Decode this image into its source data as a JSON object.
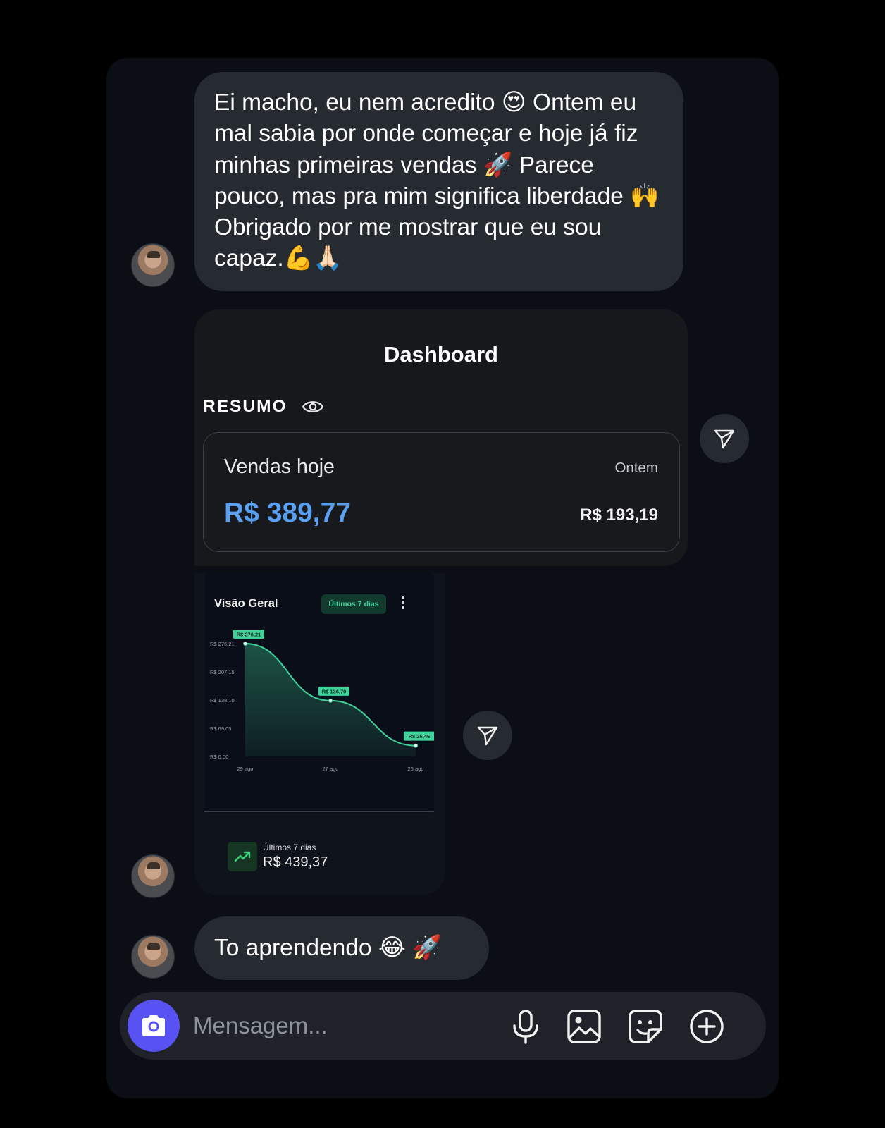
{
  "messages": {
    "first_text": "Ei macho, eu nem acredito 😍 Ontem eu mal sabia por onde começar e hoje já fiz minhas primeiras vendas 🚀 Parece pouco, mas pra mim significa liberdade 🙌 Obrigado por me mostrar que eu sou capaz.💪🙏🏻",
    "last_text": "To aprendendo 😂 🚀"
  },
  "dashboard": {
    "title": "Dashboard",
    "section_label": "RESUMO",
    "sales_label": "Vendas hoje",
    "sales_value": "R$ 389,77",
    "yesterday_label": "Ontem",
    "yesterday_value": "R$ 193,19",
    "sales_value_color": "#5aa0f2"
  },
  "overview_chart": {
    "title": "Visão Geral",
    "period_badge": "Últimos 7 dias",
    "total_label": "Últimos 7 dias",
    "total_value": "R$ 439,37"
  },
  "chart_data": {
    "type": "area",
    "title": "Visão Geral",
    "x": [
      "29 ago",
      "27 ago",
      "26 ago"
    ],
    "values": [
      276.21,
      136.7,
      26.46
    ],
    "point_labels": [
      "R$ 276,21",
      "R$ 136,70",
      "R$ 26,46"
    ],
    "y_ticks": [
      "R$ 276,21",
      "R$ 207,15",
      "R$ 138,10",
      "R$ 69,05",
      "R$ 0,00"
    ],
    "y_tick_values": [
      276.21,
      207.15,
      138.1,
      69.05,
      0
    ],
    "ylim": [
      0,
      276.21
    ],
    "grid": false,
    "color": "#3fd39b"
  },
  "composer": {
    "placeholder": "Mensagem...",
    "accent_color": "#5852f2"
  },
  "icons": {
    "camera": "camera-icon",
    "mic": "microphone-icon",
    "gallery": "image-icon",
    "sticker": "sticker-icon",
    "plus": "plus-circle-icon",
    "share": "send-icon",
    "eye": "eye-icon",
    "trend": "trending-up-icon"
  }
}
